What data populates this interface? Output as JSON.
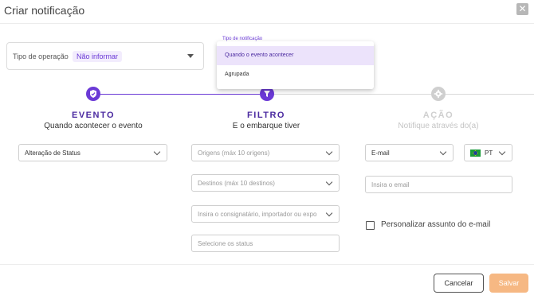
{
  "modal": {
    "title": "Criar notificação",
    "close_icon": "close-icon"
  },
  "operation": {
    "label": "Tipo de operação",
    "value": "Não informar"
  },
  "notification_type": {
    "label": "Tipo de notificação",
    "options": [
      "Quando o evento acontecer",
      "Agrupada"
    ],
    "selected": "Quando o evento acontecer"
  },
  "steps": [
    {
      "title": "EVENTO",
      "subtitle": "Quando acontecer o evento",
      "icon": "shield-check-icon",
      "active": true
    },
    {
      "title": "FILTRO",
      "subtitle": "E o embarque tiver",
      "icon": "filter-icon",
      "active": true
    },
    {
      "title": "AÇÃO",
      "subtitle": "Notifique através do(a)",
      "icon": "gear-icon",
      "active": false
    }
  ],
  "event": {
    "value": "Alteração de Status"
  },
  "filters": {
    "origins_placeholder": "Origens (máx 10 origens)",
    "destinations_placeholder": "Destinos (máx 10 destinos)",
    "consignee_placeholder": "Insira o consignatário, importador ou expo",
    "status_placeholder": "Selecione os status"
  },
  "action": {
    "channel": "E-mail",
    "language": "PT",
    "email_placeholder": "Insira o email",
    "custom_subject_label": "Personalizar assunto do e-mail",
    "custom_subject_checked": false
  },
  "footer": {
    "cancel_label": "Cancelar",
    "save_label": "Salvar"
  },
  "colors": {
    "primary": "#6b3ad6",
    "save_disabled": "#f6b883",
    "inactive": "#cfcfcf"
  }
}
